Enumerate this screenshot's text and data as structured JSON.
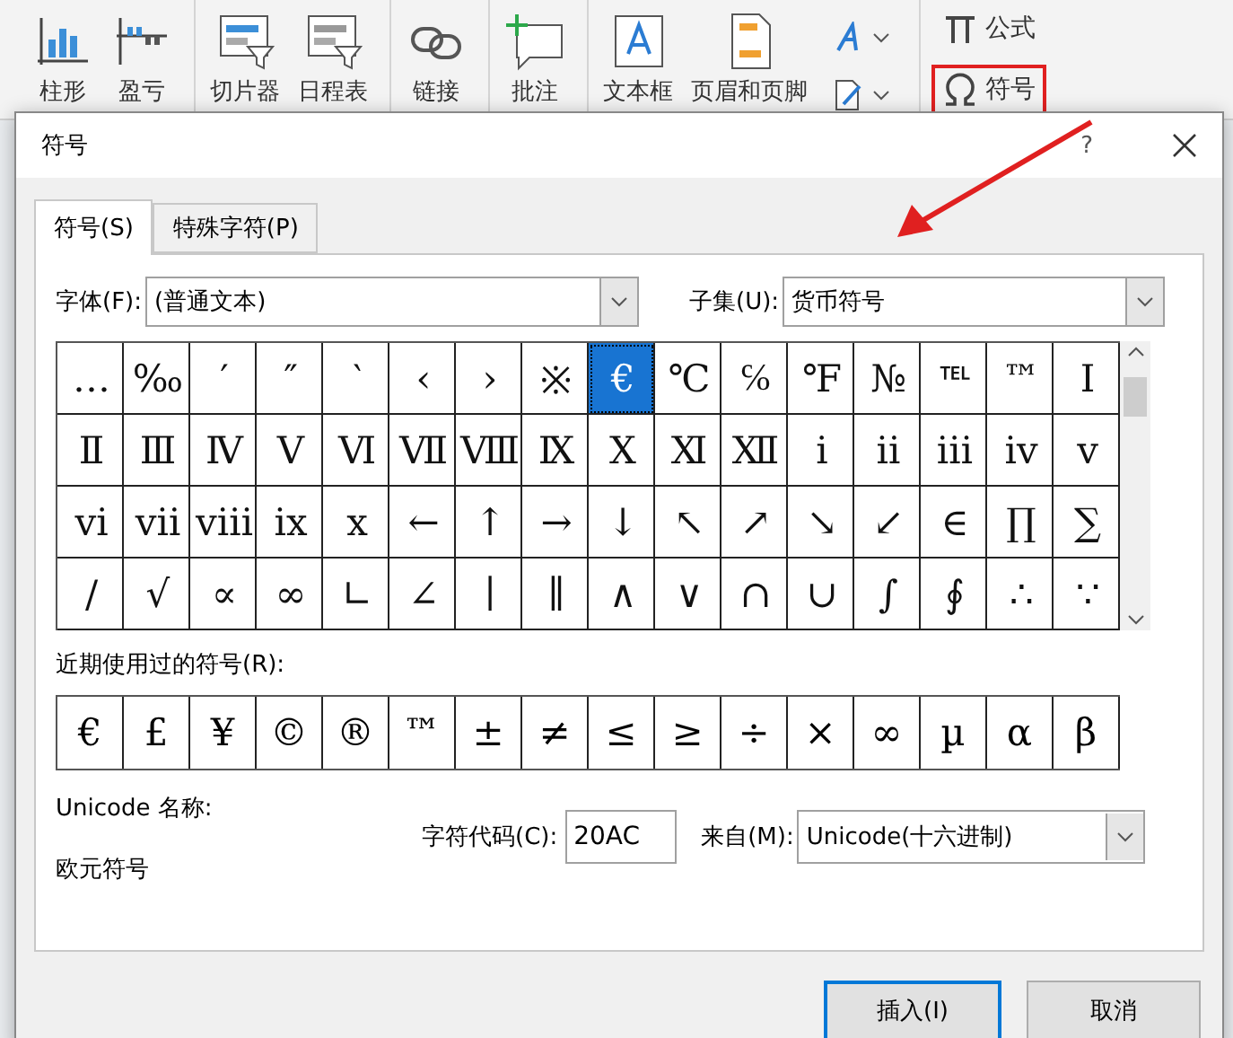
{
  "ribbon": {
    "groups": [
      {
        "items": [
          {
            "label": "柱形",
            "kind": "column"
          },
          {
            "label": "盈亏",
            "kind": "winloss"
          }
        ]
      },
      {
        "items": [
          {
            "label": "切片器",
            "kind": "slicer"
          },
          {
            "label": "日程表",
            "kind": "timeline"
          }
        ]
      },
      {
        "items": [
          {
            "label": "链接",
            "kind": "link"
          }
        ]
      },
      {
        "items": [
          {
            "label": "批注",
            "kind": "comment"
          }
        ]
      },
      {
        "items": [
          {
            "label": "文本框",
            "kind": "textbox"
          },
          {
            "label": "页眉和页脚",
            "kind": "header"
          }
        ]
      }
    ],
    "small_tools": [
      {
        "kind": "wordart"
      },
      {
        "kind": "signature"
      }
    ],
    "symbol_tools": [
      {
        "label": "公式",
        "kind": "equation",
        "highlighted": false
      },
      {
        "label": "符号",
        "kind": "symbol",
        "highlighted": true
      }
    ]
  },
  "annotation": {
    "arrow": true
  },
  "dialog": {
    "title": "符号",
    "help": "?",
    "tabs": [
      {
        "label": "符号(S)",
        "selected": true
      },
      {
        "label": "特殊字符(P)",
        "selected": false
      }
    ],
    "font_label": "字体(F):",
    "font_value": "(普通文本)",
    "subset_label": "子集(U):",
    "subset_value": "货币符号",
    "symbols": [
      [
        {
          "char": "…",
          "selected": false
        },
        {
          "char": "‰",
          "selected": false
        },
        {
          "char": "′",
          "selected": false
        },
        {
          "char": "″",
          "selected": false
        },
        {
          "char": "‵",
          "selected": false
        },
        {
          "char": "‹",
          "selected": false
        },
        {
          "char": "›",
          "selected": false
        },
        {
          "char": "※",
          "selected": false
        },
        {
          "char": "€",
          "selected": true
        },
        {
          "char": "℃",
          "selected": false
        },
        {
          "char": "℅",
          "selected": false
        },
        {
          "char": "℉",
          "selected": false
        },
        {
          "char": "№",
          "selected": false
        },
        {
          "char": "℡",
          "selected": false
        },
        {
          "char": "™",
          "selected": false
        },
        {
          "char": "Ⅰ",
          "selected": false
        }
      ],
      [
        {
          "char": "Ⅱ",
          "selected": false
        },
        {
          "char": "Ⅲ",
          "selected": false
        },
        {
          "char": "Ⅳ",
          "selected": false
        },
        {
          "char": "Ⅴ",
          "selected": false
        },
        {
          "char": "Ⅵ",
          "selected": false
        },
        {
          "char": "Ⅶ",
          "selected": false
        },
        {
          "char": "Ⅷ",
          "selected": false
        },
        {
          "char": "Ⅸ",
          "selected": false
        },
        {
          "char": "Ⅹ",
          "selected": false
        },
        {
          "char": "Ⅺ",
          "selected": false
        },
        {
          "char": "Ⅻ",
          "selected": false
        },
        {
          "char": "ⅰ",
          "selected": false
        },
        {
          "char": "ⅱ",
          "selected": false
        },
        {
          "char": "ⅲ",
          "selected": false
        },
        {
          "char": "ⅳ",
          "selected": false
        },
        {
          "char": "ⅴ",
          "selected": false
        }
      ],
      [
        {
          "char": "ⅵ",
          "selected": false
        },
        {
          "char": "ⅶ",
          "selected": false
        },
        {
          "char": "ⅷ",
          "selected": false
        },
        {
          "char": "ⅸ",
          "selected": false
        },
        {
          "char": "ⅹ",
          "selected": false
        },
        {
          "char": "←",
          "selected": false
        },
        {
          "char": "↑",
          "selected": false
        },
        {
          "char": "→",
          "selected": false
        },
        {
          "char": "↓",
          "selected": false
        },
        {
          "char": "↖",
          "selected": false
        },
        {
          "char": "↗",
          "selected": false
        },
        {
          "char": "↘",
          "selected": false
        },
        {
          "char": "↙",
          "selected": false
        },
        {
          "char": "∈",
          "selected": false
        },
        {
          "char": "∏",
          "selected": false
        },
        {
          "char": "∑",
          "selected": false
        }
      ],
      [
        {
          "char": "∕",
          "selected": false
        },
        {
          "char": "√",
          "selected": false
        },
        {
          "char": "∝",
          "selected": false
        },
        {
          "char": "∞",
          "selected": false
        },
        {
          "char": "∟",
          "selected": false
        },
        {
          "char": "∠",
          "selected": false
        },
        {
          "char": "∣",
          "selected": false
        },
        {
          "char": "∥",
          "selected": false
        },
        {
          "char": "∧",
          "selected": false
        },
        {
          "char": "∨",
          "selected": false
        },
        {
          "char": "∩",
          "selected": false
        },
        {
          "char": "∪",
          "selected": false
        },
        {
          "char": "∫",
          "selected": false
        },
        {
          "char": "∮",
          "selected": false
        },
        {
          "char": "∴",
          "selected": false
        },
        {
          "char": "∵",
          "selected": false
        }
      ]
    ],
    "recent_label": "近期使用过的符号(R):",
    "recent": [
      "€",
      "£",
      "¥",
      "©",
      "®",
      "™",
      "±",
      "≠",
      "≤",
      "≥",
      "÷",
      "×",
      "∞",
      "µ",
      "α",
      "β"
    ],
    "unicode_name_label": "Unicode 名称:",
    "unicode_name": "欧元符号",
    "code_label": "字符代码(C):",
    "code_value": "20AC",
    "from_label": "来自(M):",
    "from_value": "Unicode(十六进制)",
    "buttons": [
      {
        "label": "插入(I)",
        "default": true
      },
      {
        "label": "取消",
        "default": false
      }
    ]
  }
}
